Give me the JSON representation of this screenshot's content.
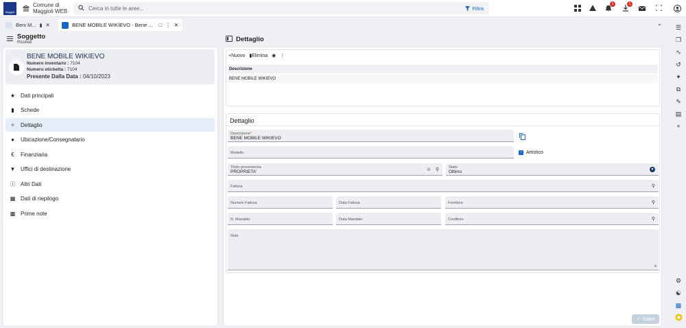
{
  "header": {
    "logo_text": "Maggioli",
    "municipality": [
      "Comune di",
      "Maggioli WEB"
    ],
    "search_placeholder": "Cerca in tutte le aree...",
    "filter_label": "Filtra",
    "notifications_badge": "1",
    "downloads_badge": "1"
  },
  "tabs": [
    {
      "label": "Beni M..."
    },
    {
      "label": "BENE MOBILE WIKIEVO - Bene ..."
    }
  ],
  "left": {
    "section_title": "Soggetto",
    "section_subtitle": "Risultati",
    "card": {
      "title": "BENE MOBILE WIKIEVO",
      "inventario_label": "Numero inventario :",
      "inventario_value": "7104",
      "etichetta_label": "Numero etichetta :",
      "etichetta_value": "7104",
      "data_label": "Presente Dalla Data :",
      "data_value": "04/10/2023"
    },
    "nav": [
      {
        "label": "Dati principali",
        "icon": "star-icon"
      },
      {
        "label": "Schede",
        "icon": "file-icon"
      },
      {
        "label": "Dettaglio",
        "icon": "magic-wand-icon"
      },
      {
        "label": "Ubicazione/Consegnatario",
        "icon": "person-icon"
      },
      {
        "label": "Finanziaria",
        "icon": "euro-icon"
      },
      {
        "label": "Uffici di destinazione",
        "icon": "pin-icon"
      },
      {
        "label": "Altri Dati",
        "icon": "info-icon"
      },
      {
        "label": "Dati di riepilogo",
        "icon": "calculator-icon"
      },
      {
        "label": "Prime note",
        "icon": "table-icon"
      }
    ]
  },
  "right": {
    "section_title": "Dettaglio",
    "toolbar": {
      "new_label": "Nuovo",
      "delete_label": "Elimina"
    },
    "table": {
      "header": "Descrizione",
      "rows": [
        "BENE MOBILE WIKIEVO"
      ]
    },
    "form": {
      "title": "Dettaglio",
      "descrizione_label": "Descrizione",
      "descrizione_value": "BENE MOBILE WIKIEVO",
      "modello_label": "Modello",
      "artistico_label": "Artistico",
      "titolo_label": "Titolo provenienza",
      "titolo_value": "PROPRIETA'",
      "stato_label": "Stato",
      "stato_value": "Ottimo",
      "fattura_label": "Fattura",
      "numero_fattura_label": "Numero Fattura",
      "data_fattura_label": "Data Fattura",
      "fornitore_label": "Fornitore",
      "n_mandato_label": "N. Mandato",
      "data_mandato_label": "Data Mandato",
      "creditore_label": "Creditore",
      "note_label": "Note"
    },
    "save_label": "Salva"
  }
}
